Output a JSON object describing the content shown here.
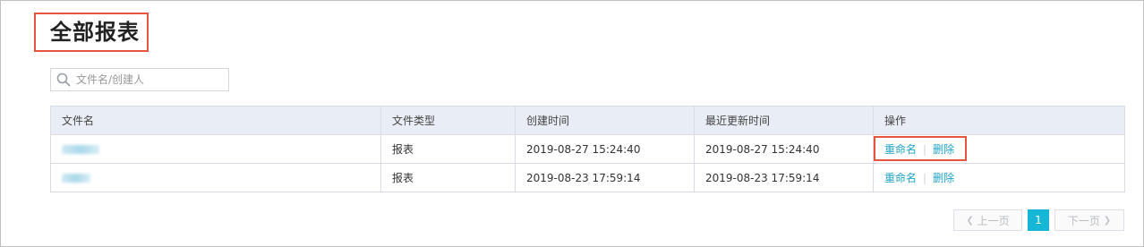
{
  "page": {
    "title": "全部报表"
  },
  "search": {
    "placeholder": "文件名/创建人",
    "value": ""
  },
  "table": {
    "columns": [
      "文件名",
      "文件类型",
      "创建时间",
      "最近更新时间",
      "操作"
    ],
    "rows": [
      {
        "name": "",
        "type": "报表",
        "created": "2019-08-27 15:24:40",
        "updated": "2019-08-27 15:24:40",
        "actions": [
          "重命名",
          "删除"
        ]
      },
      {
        "name": "",
        "type": "报表",
        "created": "2019-08-23 17:59:14",
        "updated": "2019-08-23 17:59:14",
        "actions": [
          "重命名",
          "删除"
        ]
      }
    ]
  },
  "pagination": {
    "prev_label": "上一页",
    "current_page": "1",
    "next_label": "下一页"
  },
  "colors": {
    "accent": "#16b6d6",
    "link": "#20a5c6",
    "highlight_box": "#e8553e",
    "header_bg": "#e9edf6"
  }
}
